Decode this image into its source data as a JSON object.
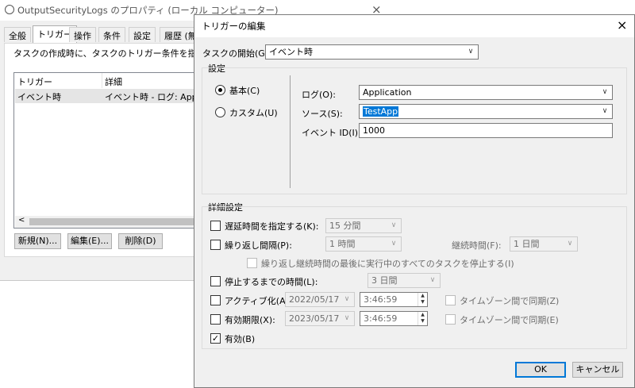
{
  "bg_window": {
    "title": "OutputSecurityLogs のプロパティ (ローカル コンピューター)",
    "tabs": [
      "全般",
      "トリガー",
      "操作",
      "条件",
      "設定",
      "履歴 (無"
    ],
    "description": "タスクの作成時に、タスクのトリガー条件を指定できます",
    "columns": [
      "トリガー",
      "詳細"
    ],
    "row": {
      "trigger": "イベント時",
      "details": "イベント時 - ログ: Applica"
    },
    "buttons": {
      "new": "新規(N)...",
      "edit": "編集(E)...",
      "delete": "削除(D)"
    },
    "scroll_left": "<"
  },
  "dialog": {
    "title": "トリガーの編集",
    "begin_label": "タスクの開始(G):",
    "begin_value": "イベント時",
    "settings_label": "設定",
    "basic_label": "基本(C)",
    "custom_label": "カスタム(U)",
    "log_label": "ログ(O):",
    "log_value": "Application",
    "source_label": "ソース(S):",
    "source_value": "TestApp",
    "eventid_label": "イベント ID(I):",
    "eventid_value": "1000",
    "advanced_label": "詳細設定",
    "delay_label": "遅延時間を指定する(K):",
    "delay_value": "15 分間",
    "repeat_label": "繰り返し間隔(P):",
    "repeat_value": "1 時間",
    "duration_label": "継続時間(F):",
    "duration_value": "1 日間",
    "stop_all_label": "繰り返し継続時間の最後に実行中のすべてのタスクを停止する(I)",
    "stop_after_label": "停止するまでの時間(L):",
    "stop_after_value": "3 日間",
    "activate_label": "アクティブ化(A):",
    "activate_date": "2022/05/17",
    "activate_time": "3:46:59",
    "expire_label": "有効期限(X):",
    "expire_date": "2023/05/17",
    "expire_time": "3:46:59",
    "sync_tz_label_1": "タイムゾーン間で同期(Z)",
    "sync_tz_label_2": "タイムゾーン間で同期(E)",
    "enabled_label": "有効(B)",
    "ok": "OK",
    "cancel": "キャンセル",
    "close": "×",
    "enabled_check": "✓"
  },
  "colors": {
    "accent": "#0078d7",
    "window_bg": "#f0f0f0"
  }
}
